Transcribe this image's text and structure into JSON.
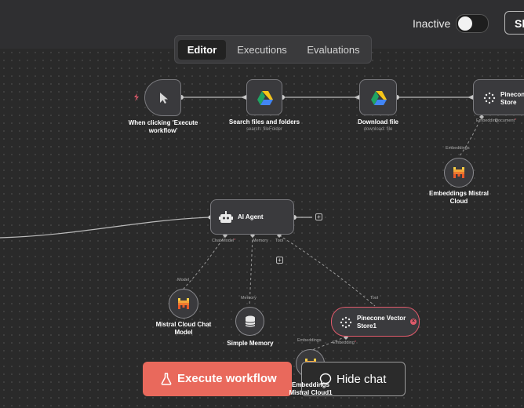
{
  "header": {
    "status_label": "Inactive",
    "share_label": "Sh",
    "tabs": [
      {
        "label": "Editor",
        "active": true
      },
      {
        "label": "Executions",
        "active": false
      },
      {
        "label": "Evaluations",
        "active": false
      }
    ]
  },
  "nodes": {
    "trigger": {
      "label": "When clicking 'Execute workflow'"
    },
    "search": {
      "label": "Search files and folders",
      "sub": "search: fileFolder"
    },
    "download": {
      "label": "Download file",
      "sub": "download: file"
    },
    "pinecone_store": {
      "label": "Pinecone Store",
      "port_left": "Embedding",
      "port_right": "Document",
      "port_req": "*"
    },
    "embeddings_top": {
      "label": "Embeddings Mistral Cloud",
      "port": "Embeddings"
    },
    "agent": {
      "label": "AI Agent",
      "ports": {
        "chat_model": "Chat Model",
        "chat_model_req": "*",
        "memory": "Memory",
        "tool": "Tool"
      }
    },
    "mistral_chat": {
      "label": "Mistral Cloud Chat Model",
      "port": "Model"
    },
    "memory": {
      "label": "Simple Memory",
      "port": "Memory"
    },
    "pinecone_vector": {
      "label": "Pinecone Vector Store1",
      "port_top": "Tool",
      "port_bottom": "Embedding",
      "port_req": "*"
    },
    "embeddings_bottom": {
      "label": "Embeddings Mistral Cloud1",
      "port": "Embeddings"
    }
  },
  "footer": {
    "execute_label": "Execute workflow",
    "hide_chat_label": "Hide chat"
  },
  "colors": {
    "accent": "#e9695c",
    "error": "#e05a6b",
    "canvas": "#2a2a2a"
  }
}
